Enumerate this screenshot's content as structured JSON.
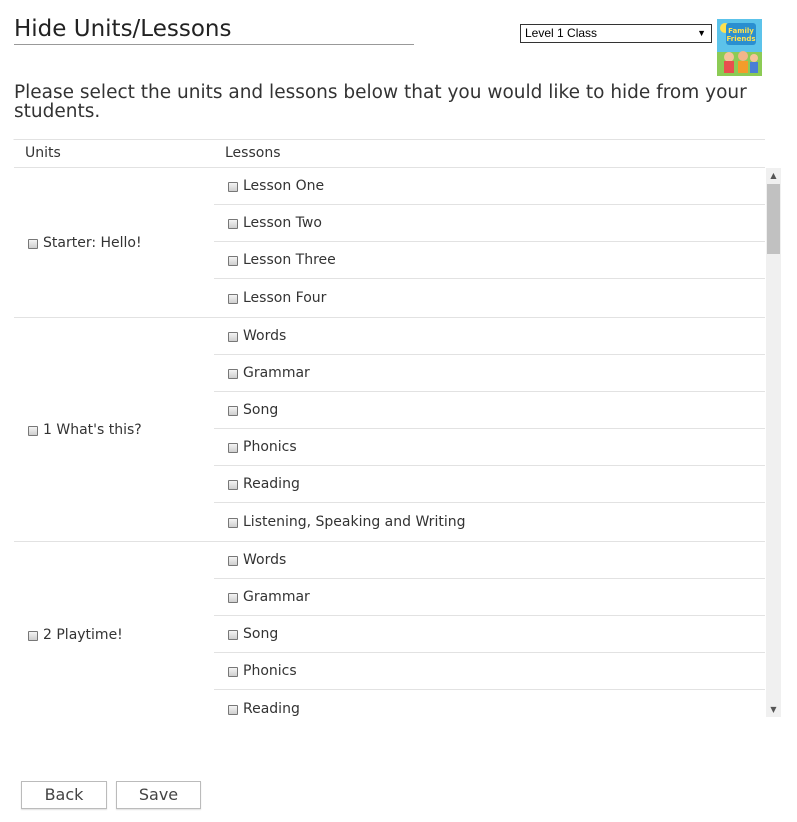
{
  "header": {
    "title": "Hide Units/Lessons",
    "class_select": {
      "selected": "Level 1 Class"
    },
    "book_cover": {
      "title_text": "Family and Friends",
      "accent": "#45b3e0"
    }
  },
  "instructions": "Please select the units and lessons below that you would like to hide from your students.",
  "table": {
    "columns": {
      "units": "Units",
      "lessons": "Lessons"
    },
    "units": [
      {
        "name": "Starter: Hello!",
        "lessons": [
          "Lesson One",
          "Lesson Two",
          "Lesson Three",
          "Lesson Four"
        ]
      },
      {
        "name": "1 What's this?",
        "lessons": [
          "Words",
          "Grammar",
          "Song",
          "Phonics",
          "Reading",
          "Listening, Speaking and Writing"
        ]
      },
      {
        "name": "2 Playtime!",
        "lessons": [
          "Words",
          "Grammar",
          "Song",
          "Phonics",
          "Reading"
        ]
      }
    ]
  },
  "buttons": {
    "back": "Back",
    "save": "Save"
  }
}
